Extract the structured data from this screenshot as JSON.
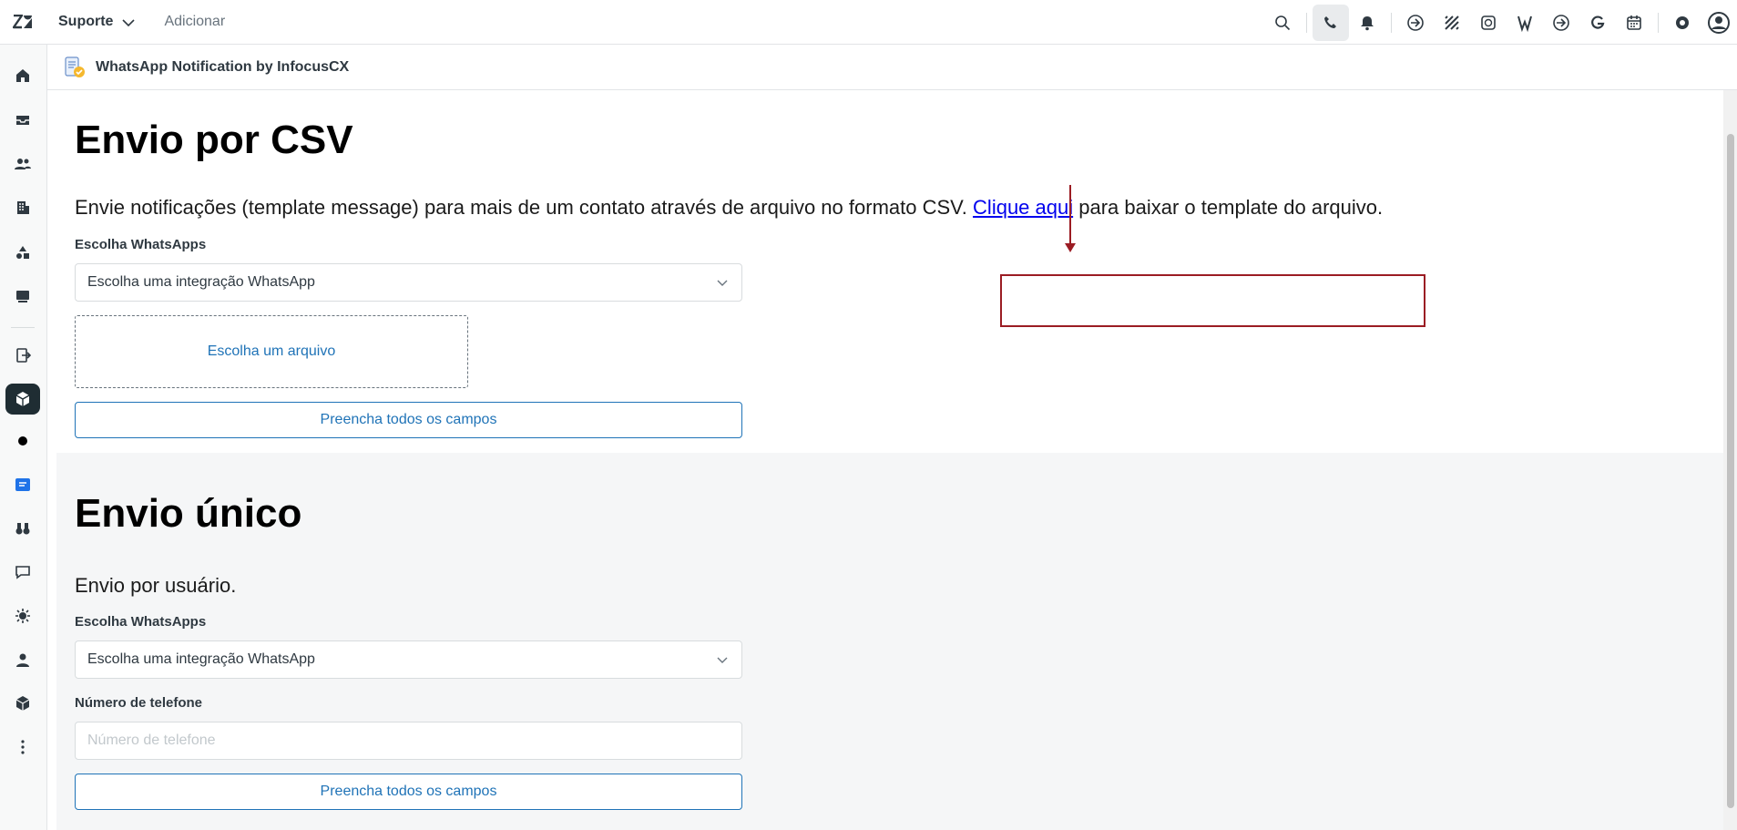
{
  "topbar": {
    "product_label": "Suporte",
    "add_label": "Adicionar"
  },
  "app": {
    "title": "WhatsApp Notification by InfocusCX"
  },
  "csv_section": {
    "heading": "Envio por CSV",
    "description_before": "Envie notificações (template message) para mais de um contato através de arquivo no formato CSV.",
    "link_text": "Clique aqui",
    "description_after": "para baixar o template do arquivo.",
    "whatsapp_label": "Escolha WhatsApps",
    "whatsapp_select_value": "Escolha uma integração WhatsApp",
    "file_drop_label": "Escolha um arquivo",
    "submit_label": "Preencha todos os campos"
  },
  "single_section": {
    "heading": "Envio único",
    "description": "Envio por usuário.",
    "whatsapp_label": "Escolha WhatsApps",
    "whatsapp_select_value": "Escolha uma integração WhatsApp",
    "phone_label": "Número de telefone",
    "phone_placeholder": "Número de telefone",
    "submit_label": "Preencha todos os campos"
  },
  "colors": {
    "annotation": "#9b1c23",
    "accent": "#1f73b7"
  }
}
